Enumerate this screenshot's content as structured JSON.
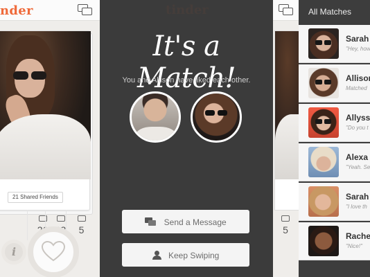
{
  "left_screen": {
    "brand": "nder",
    "shared_friends": "21 Shared Friends",
    "stats": [
      {
        "icon": "friends-icon",
        "value": "21"
      },
      {
        "icon": "book-icon",
        "value": "13"
      },
      {
        "icon": "camera-icon",
        "value": "5"
      }
    ],
    "info_label": "i"
  },
  "match_screen": {
    "title": "It's a Match!",
    "subtitle": "You and Allison have liked each other.",
    "send_message_label": "Send a Message",
    "keep_swiping_label": "Keep Swiping"
  },
  "strip_screen": {
    "stat_value": "5"
  },
  "matches_screen": {
    "header": "All Matches",
    "items": [
      {
        "name": "Sarah",
        "message": "\"Hey, how"
      },
      {
        "name": "Allison",
        "message": "Matched"
      },
      {
        "name": "Allyssa",
        "message": "\"Do you t"
      },
      {
        "name": "Alexa",
        "message": "\"Yeah. Se"
      },
      {
        "name": "Sarah",
        "message": "\"I love th"
      },
      {
        "name": "Rache",
        "message": "\"Nice!\""
      }
    ]
  },
  "colors": {
    "brand_orange": "#ef6a3a",
    "match_bg": "#3b3b3b",
    "list_bg": "#3d3d3d"
  }
}
